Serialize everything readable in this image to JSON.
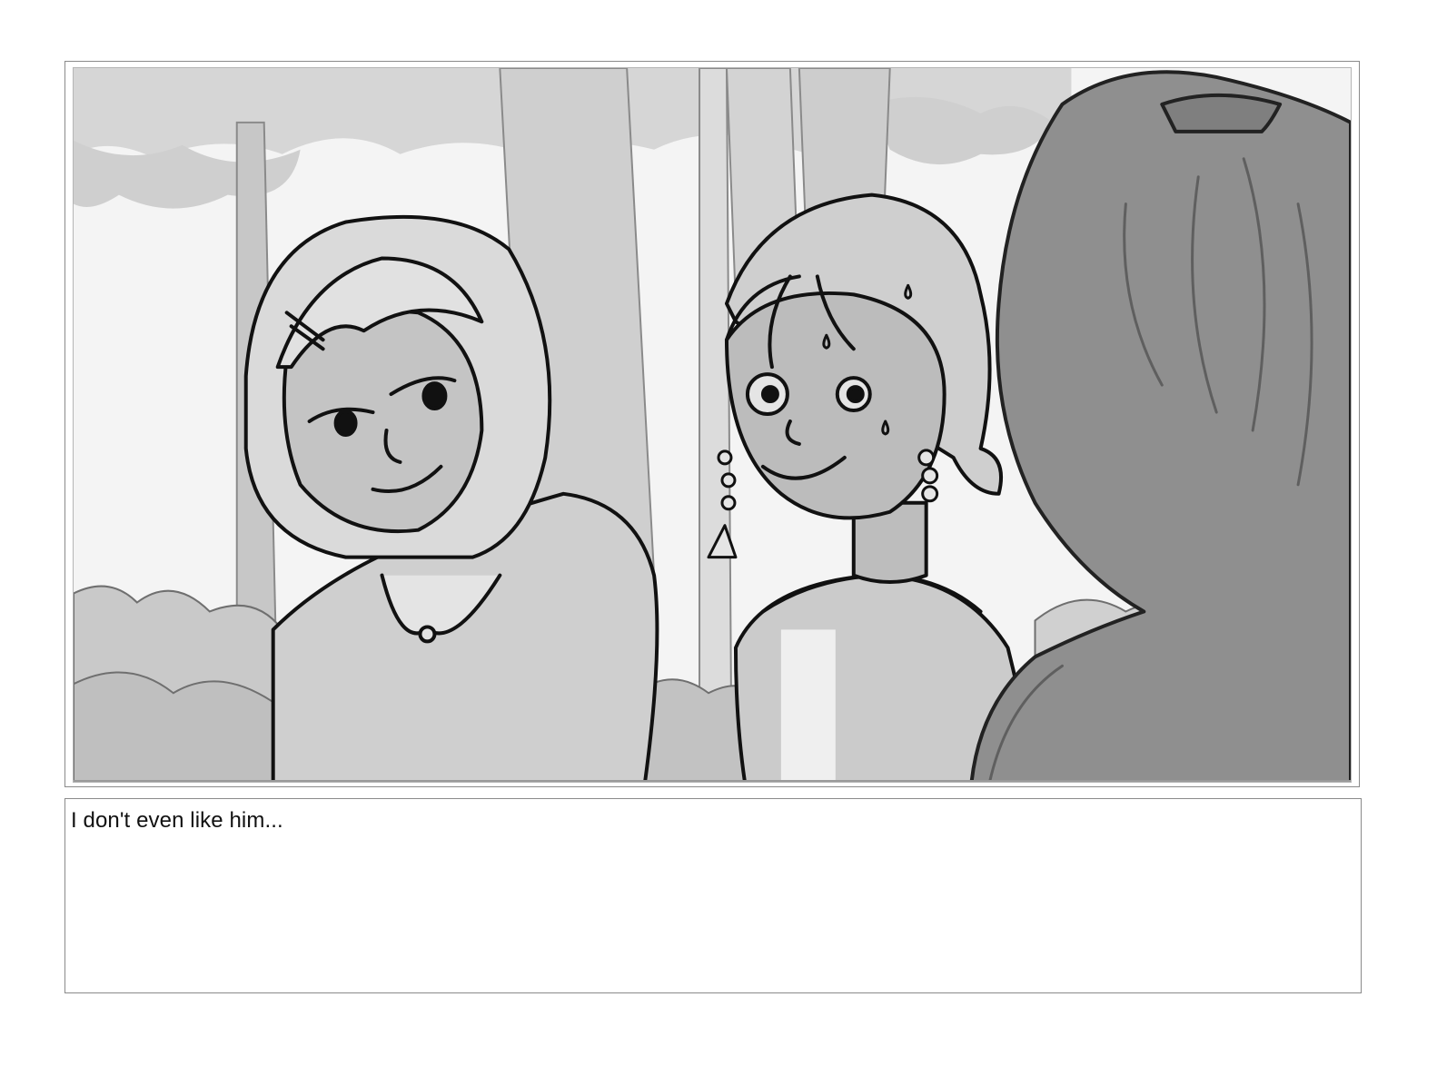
{
  "storyboard": {
    "panel": {
      "illustration": "storyboard-sketch"
    },
    "caption": {
      "text": "I don't even like him..."
    }
  },
  "colors": {
    "line": "#111111",
    "tone_light": "#d9d9d9",
    "tone_mid": "#bdbdbd",
    "tone_dark": "#8e8e8e",
    "paper": "#ffffff"
  }
}
